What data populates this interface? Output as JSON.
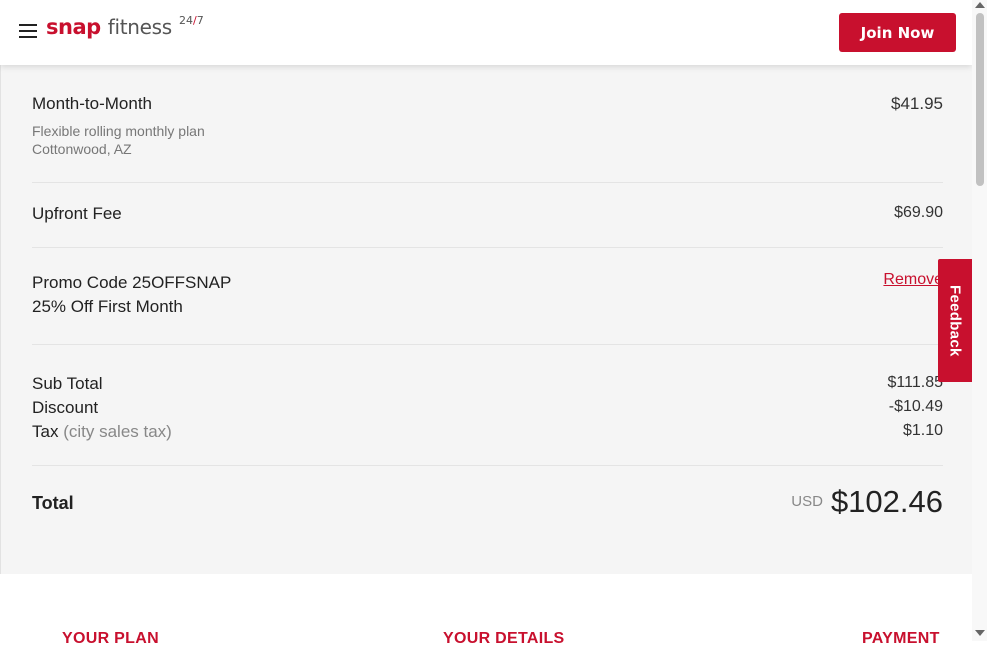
{
  "header": {
    "logo": {
      "snap": "snap",
      "fitness": "fitness",
      "hours_left": "24",
      "slash": "/",
      "hours_right": "7"
    },
    "join_button": "Join Now"
  },
  "summary": {
    "plan": {
      "name": "Month-to-Month",
      "price": "$41.95",
      "description": "Flexible rolling monthly plan",
      "location": "Cottonwood, AZ"
    },
    "upfront_fee": {
      "label": "Upfront Fee",
      "value": "$69.90"
    },
    "promo": {
      "code_label": "Promo Code 25OFFSNAP",
      "description": "25% Off First Month",
      "remove_label": "Remove"
    },
    "subtotal": {
      "label": "Sub Total",
      "value": "$111.85"
    },
    "discount": {
      "label": "Discount",
      "value": "-$10.49"
    },
    "tax": {
      "label": "Tax",
      "qualifier": "(city sales tax)",
      "value": "$1.10"
    },
    "total": {
      "label": "Total",
      "currency": "USD",
      "amount": "$102.46"
    }
  },
  "feedback_tab": "Feedback",
  "steps": [
    "YOUR PLAN",
    "YOUR DETAILS",
    "PAYMENT"
  ],
  "colors": {
    "brand_red": "#c8102e",
    "summary_bg": "#f5f5f5",
    "text": "#222222"
  },
  "icons": {
    "menu": "hamburger-menu-icon"
  }
}
